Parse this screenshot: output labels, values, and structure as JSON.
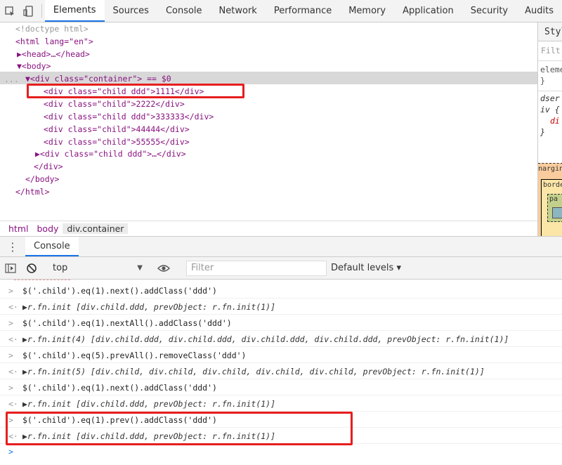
{
  "devtools": {
    "tabs": [
      "Elements",
      "Sources",
      "Console",
      "Network",
      "Performance",
      "Memory",
      "Application",
      "Security",
      "Audits"
    ],
    "active_tab": "Elements"
  },
  "elements": {
    "lines": [
      "<!doctype html>",
      "<html lang=\"en\">",
      "▶<head>…</head>",
      "▼<body>",
      "▼<div class=\"container\"> == $0",
      "<div class=\"child ddd\">1111</div>",
      "<div class=\"child\">2222</div>",
      "<div class=\"child ddd\">333333</div>",
      "<div class=\"child\">44444</div>",
      "<div class=\"child\">55555</div>",
      "▶<div class=\"child ddd\">…</div>",
      "</div>",
      "</body>",
      "</html>"
    ],
    "row_ellipsis": "..."
  },
  "styles_panel": {
    "header": "Style",
    "filter_placeholder": "Filt",
    "lines": [
      "eleme",
      "}",
      "dser",
      "iv {",
      "di",
      "}"
    ],
    "box_model": [
      "nargin",
      "borde",
      "pa",
      "-"
    ]
  },
  "breadcrumb": [
    "html",
    "body",
    "div.container"
  ],
  "drawer": {
    "tab_label": "Console"
  },
  "console_toolbar": {
    "context": "top",
    "filter_placeholder": "Filter",
    "levels": "Default levels ▾"
  },
  "console_lines": [
    {
      "type": "input",
      "prompt": ">",
      "text": "$('.child').eq(1).next().addClass('ddd')"
    },
    {
      "type": "output",
      "prompt": "<·",
      "text": "▶r.fn.init [div.child.ddd, prevObject: r.fn.init(1)]"
    },
    {
      "type": "input",
      "prompt": ">",
      "text": "$('.child').eq(1).nextAll().addClass('ddd')"
    },
    {
      "type": "output",
      "prompt": "<·",
      "text": "▶r.fn.init(4) [div.child.ddd, div.child.ddd, div.child.ddd, div.child.ddd, prevObject: r.fn.init(1)]"
    },
    {
      "type": "input",
      "prompt": ">",
      "text": "$('.child').eq(5).prevAll().removeClass('ddd')"
    },
    {
      "type": "output",
      "prompt": "<·",
      "text": "▶r.fn.init(5) [div.child, div.child, div.child, div.child, div.child, prevObject: r.fn.init(1)]"
    },
    {
      "type": "input",
      "prompt": ">",
      "text": "$('.child').eq(1).next().addClass('ddd')"
    },
    {
      "type": "output",
      "prompt": "<·",
      "text": "▶r.fn.init [div.child.ddd, prevObject: r.fn.init(1)]"
    },
    {
      "type": "input",
      "prompt": ">",
      "text": "$('.child').eq(1).prev().addClass('ddd')"
    },
    {
      "type": "output",
      "prompt": "<·",
      "text": "▶r.fn.init [div.child.ddd, prevObject: r.fn.init(1)]"
    }
  ],
  "console_prompt": ">",
  "colors": {
    "highlight_box": "#e61e1e",
    "active_tab_underline": "#1a73e8",
    "tag": "#881280",
    "attr_value": "#1a1aa6"
  }
}
